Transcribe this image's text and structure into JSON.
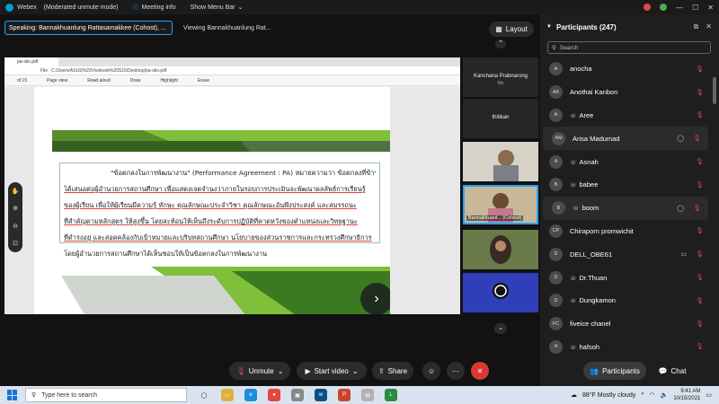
{
  "titlebar": {
    "app": "Webex",
    "mode": "(Moderated unmute mode)",
    "meeting_info": "Meeting info",
    "menu": "Show Menu Bar"
  },
  "speaking": "Speaking: Bannakhuanlung Rattasamakkee (Cohost), ...",
  "viewing": "Viewing Bannakhuanlung Rat...",
  "layout_label": "Layout",
  "browser": {
    "tab_label": "pa-skn.pdf",
    "url": "C:/Users/ASUS%20Vivobook%20S15/Desktop/pa-skn.pdf",
    "file_label": "File",
    "page_of": "of 15",
    "tools": [
      "Page view",
      "Read aloud",
      "Draw",
      "Highlight",
      "Erase"
    ]
  },
  "pdf": {
    "lines": [
      "\"ข้อตกลงในการพัฒนางาน\" (Performance Agreement : PA) หมายความว่า ข้อตกลงที่ข้าราชการครู",
      "ได้เสนอต่อผู้อำนวยการสถานศึกษา เพื่อแสดงเจตจำนงว่าภายในรอบการประเมินจะพัฒนาผลลัพธ์การเรียนรู้",
      "ของผู้เรียน เพื่อให้ผู้เรียนมีความรู้ ทักษะ คุณลักษณะประจำวิชา คุณลักษณะอันพึงประสงค์ และสมรรถนะ",
      "ที่สำคัญตามหลักสูตร ให้สูงขึ้น โดยสะท้อนให้เห็นถึงระดับการปฏิบัติที่คาดหวังของตำแหน่งและวิทยฐานะ",
      "ที่ดำรงอยู่ และสอดคล้องกับเป้าหมายและบริบทสถานศึกษา นโยบายของส่วนราชการและกระทรวงศึกษาธิการ",
      "โดยผู้อำนวยการสถานศึกษาได้เห็นชอบให้เป็นข้อตกลงในการพัฒนางาน"
    ]
  },
  "strip": {
    "tiles": [
      {
        "name": "Kanchana Prabnarong",
        "sub": "Me"
      },
      {
        "name": "thitikan",
        "sub": ""
      },
      {
        "name": "",
        "sub": ""
      },
      {
        "name": "Bannakhuanl... (Cohost)",
        "sub": ""
      },
      {
        "name": "",
        "sub": ""
      },
      {
        "name": "",
        "sub": ""
      }
    ]
  },
  "panel": {
    "title": "Participants (247)",
    "search_placeholder": "Search",
    "participants": [
      {
        "initials": "A",
        "name": "anocha",
        "phone": false
      },
      {
        "initials": "AK",
        "name": "Anothai Kanbon",
        "phone": false
      },
      {
        "initials": "A",
        "name": "Aree",
        "phone": true
      },
      {
        "initials": "AM",
        "name": "Arisa Madumad",
        "phone": false,
        "chat": true
      },
      {
        "initials": "A",
        "name": "Asnah",
        "phone": true
      },
      {
        "initials": "B",
        "name": "babee",
        "phone": true
      },
      {
        "initials": "B",
        "name": "boom",
        "phone": true,
        "chat": true
      },
      {
        "initials": "CP",
        "name": "Chiraporn promwichit",
        "phone": false
      },
      {
        "initials": "D",
        "name": "DELL_OBE61",
        "phone": false,
        "video": true
      },
      {
        "initials": "D",
        "name": "Dr.Thuan",
        "phone": true
      },
      {
        "initials": "D",
        "name": "Dungkamon",
        "phone": true
      },
      {
        "initials": "FC",
        "name": "fiveice chanel",
        "phone": false
      },
      {
        "initials": "H",
        "name": "hafsoh",
        "phone": true
      }
    ]
  },
  "controls": {
    "unmute": "Unmute",
    "start_video": "Start video",
    "share": "Share",
    "participants": "Participants",
    "chat": "Chat"
  },
  "taskbar": {
    "search": "Type here to search",
    "weather": "88°F  Mostly cloudy",
    "time": "9:41 AM",
    "date": "10/15/2021"
  },
  "colors": {
    "accent": "#2aa3ff",
    "mute_red": "#e04848",
    "end_call": "#d93636"
  }
}
